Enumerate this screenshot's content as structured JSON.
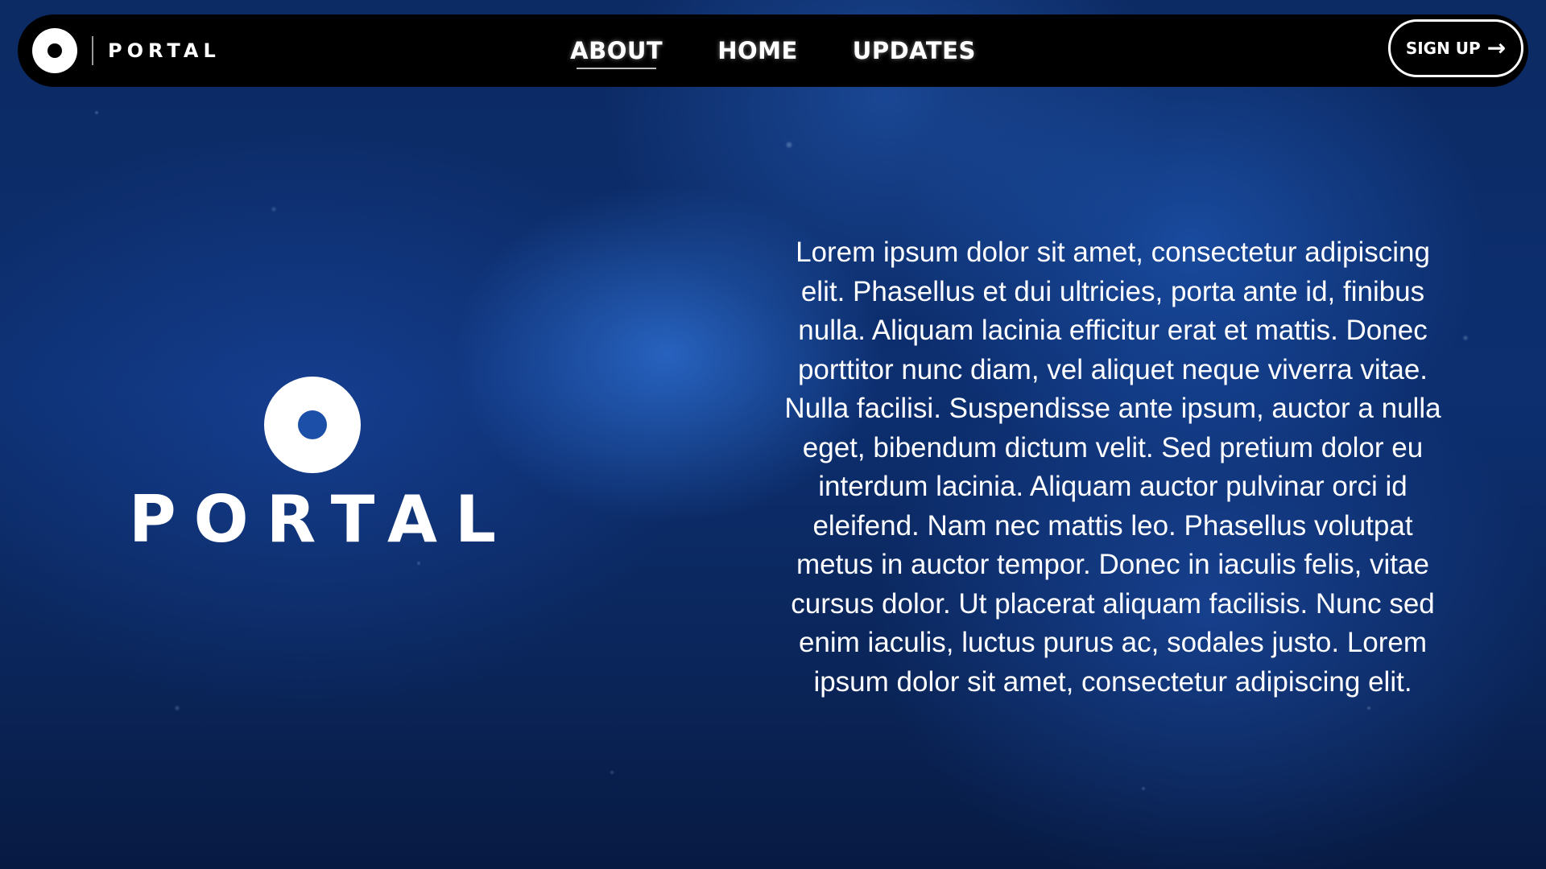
{
  "header": {
    "brand_name": "PORTAL",
    "brand_icon": "ring-logo-icon",
    "nav_links": [
      "ABOUT",
      "HOME",
      "UPDATES"
    ],
    "active_link": "ABOUT",
    "signup_label": "SIGN UP",
    "signup_icon": "arrow-right-icon",
    "signup_arrow": "→"
  },
  "hero": {
    "logo_icon": "ring-logo-icon",
    "logo_text": "PORTAL"
  },
  "content": {
    "paragraph": "Lorem ipsum dolor sit amet, consectetur adipiscing elit. Phasellus et dui ultricies, porta ante id, finibus nulla. Aliquam lacinia efficitur erat et mattis. Donec porttitor nunc diam, vel aliquet neque viverra vitae. Nulla facilisi. Suspendisse ante ipsum, auctor a nulla eget, bibendum dictum velit. Sed pretium dolor eu interdum lacinia. Aliquam auctor pulvinar orci id eleifend. Nam nec mattis leo. Phasellus volutpat metus in auctor tempor. Donec in iaculis felis, vitae cursus dolor. Ut placerat aliquam facilisis. Nunc sed enim iaculis, luctus purus ac, sodales justo. Lorem ipsum dolor sit amet, consectetur adipiscing elit."
  },
  "colors": {
    "navbar_background": "#000000",
    "text": "#ffffff",
    "background_primary": "#0d2f70",
    "background_accent": "#3c8cff"
  }
}
